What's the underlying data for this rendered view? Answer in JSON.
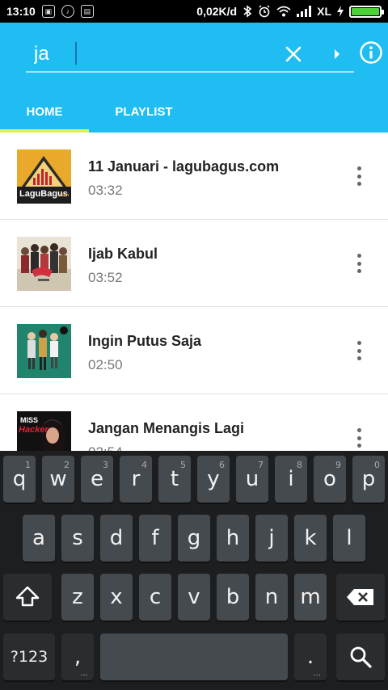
{
  "status_bar": {
    "time": "13:10",
    "notif_icons": [
      "image-icon",
      "app-icon",
      "app2-icon"
    ],
    "speed": "0,02K/d",
    "carrier": "XL",
    "battery_color": "#4cd137"
  },
  "search": {
    "value": "ja",
    "placeholder": ""
  },
  "tabs": [
    {
      "label": "HOME",
      "active": true
    },
    {
      "label": "PLAYLIST",
      "active": false
    }
  ],
  "songs": [
    {
      "title": "11 Januari - lagubagus.com",
      "duration": "03:32",
      "cover": "lagubagus-cover"
    },
    {
      "title": "Ijab Kabul",
      "duration": "03:52",
      "cover": "band-cover"
    },
    {
      "title": "Ingin Putus Saja",
      "duration": "02:50",
      "cover": "group-cover"
    },
    {
      "title": "Jangan Menangis Lagi",
      "duration": "02:54",
      "cover": "miss-hacker-cover"
    }
  ],
  "cover_text": {
    "lagubagus": "LaguBagus",
    "lagubagus_com": ".com",
    "miss": "MISS",
    "hacker": "Hacker"
  },
  "keyboard": {
    "row1": [
      {
        "key": "q",
        "hint": "1"
      },
      {
        "key": "w",
        "hint": "2"
      },
      {
        "key": "e",
        "hint": "3"
      },
      {
        "key": "r",
        "hint": "4"
      },
      {
        "key": "t",
        "hint": "5"
      },
      {
        "key": "y",
        "hint": "6"
      },
      {
        "key": "u",
        "hint": "7"
      },
      {
        "key": "i",
        "hint": "8"
      },
      {
        "key": "o",
        "hint": "9"
      },
      {
        "key": "p",
        "hint": "0"
      }
    ],
    "row2": [
      "a",
      "s",
      "d",
      "f",
      "g",
      "h",
      "j",
      "k",
      "l"
    ],
    "row3": [
      "z",
      "x",
      "c",
      "v",
      "b",
      "n",
      "m"
    ],
    "symbols_label": "?123",
    "comma": ",",
    "period": "."
  },
  "colors": {
    "app_bar": "#1fbdf1",
    "tab_indicator": "#d9f25a"
  }
}
